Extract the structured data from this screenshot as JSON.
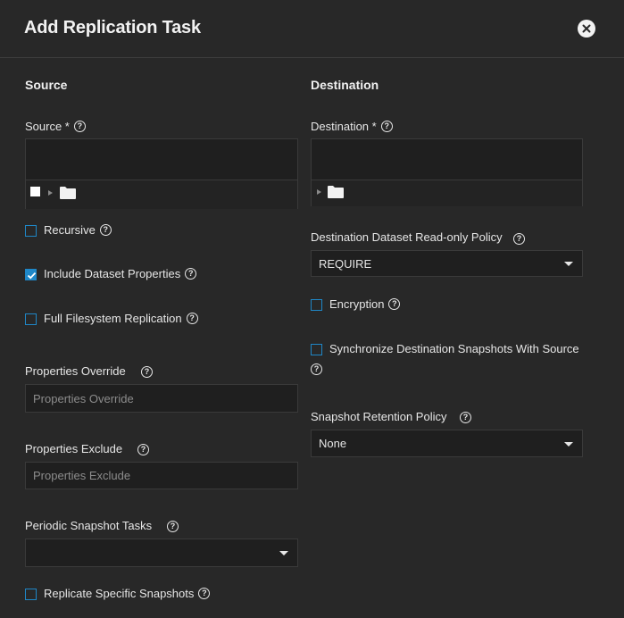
{
  "dialog": {
    "title": "Add Replication Task",
    "close_icon": "close-icon"
  },
  "source": {
    "section_title": "Source",
    "source_label": "Source *",
    "recursive_label": "Recursive",
    "recursive_checked": false,
    "include_props_label": "Include Dataset Properties",
    "include_props_checked": true,
    "full_fs_label": "Full Filesystem Replication",
    "full_fs_checked": false,
    "props_override_label": "Properties Override",
    "props_override_placeholder": "Properties Override",
    "props_exclude_label": "Properties Exclude",
    "props_exclude_placeholder": "Properties Exclude",
    "periodic_label": "Periodic Snapshot Tasks",
    "periodic_value": "",
    "replicate_specific_label": "Replicate Specific Snapshots",
    "replicate_specific_checked": false
  },
  "destination": {
    "section_title": "Destination",
    "destination_label": "Destination *",
    "readonly_policy_label": "Destination Dataset Read-only Policy",
    "readonly_policy_value": "REQUIRE",
    "encryption_label": "Encryption",
    "encryption_checked": false,
    "sync_label": "Synchronize Destination Snapshots With Source",
    "sync_checked": false,
    "retention_label": "Snapshot Retention Policy",
    "retention_value": "None"
  },
  "colors": {
    "background": "#282828",
    "field_background": "#1f1f1f",
    "accent": "#1f87c7",
    "text": "#e6e6e6"
  }
}
